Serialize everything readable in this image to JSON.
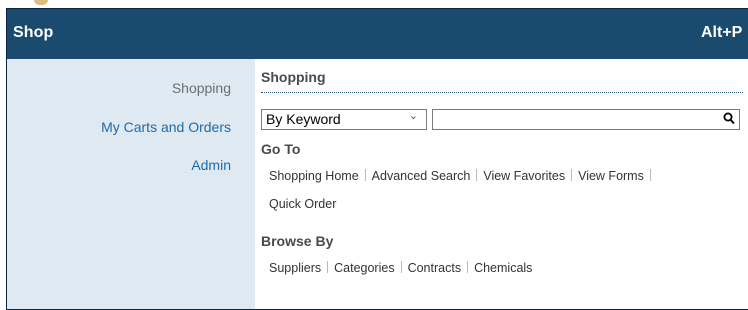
{
  "header": {
    "title": "Shop",
    "shortcut": "Alt+P"
  },
  "sidebar": {
    "items": [
      {
        "label": "Shopping",
        "active": true
      },
      {
        "label": "My Carts and Orders",
        "active": false
      },
      {
        "label": "Admin",
        "active": false
      }
    ]
  },
  "main": {
    "section_title": "Shopping",
    "search_type": {
      "selected": "By Keyword"
    },
    "search_input": {
      "value": ""
    },
    "goto": {
      "title": "Go To",
      "links": [
        "Shopping Home",
        "Advanced Search",
        "View Favorites",
        "View Forms",
        "Quick Order"
      ]
    },
    "browse": {
      "title": "Browse By",
      "links": [
        "Suppliers",
        "Categories",
        "Contracts",
        "Chemicals"
      ]
    }
  },
  "colors": {
    "header_bg": "#1a4a6e",
    "sidebar_bg": "#dfe9f2",
    "link": "#1e6ba8"
  }
}
